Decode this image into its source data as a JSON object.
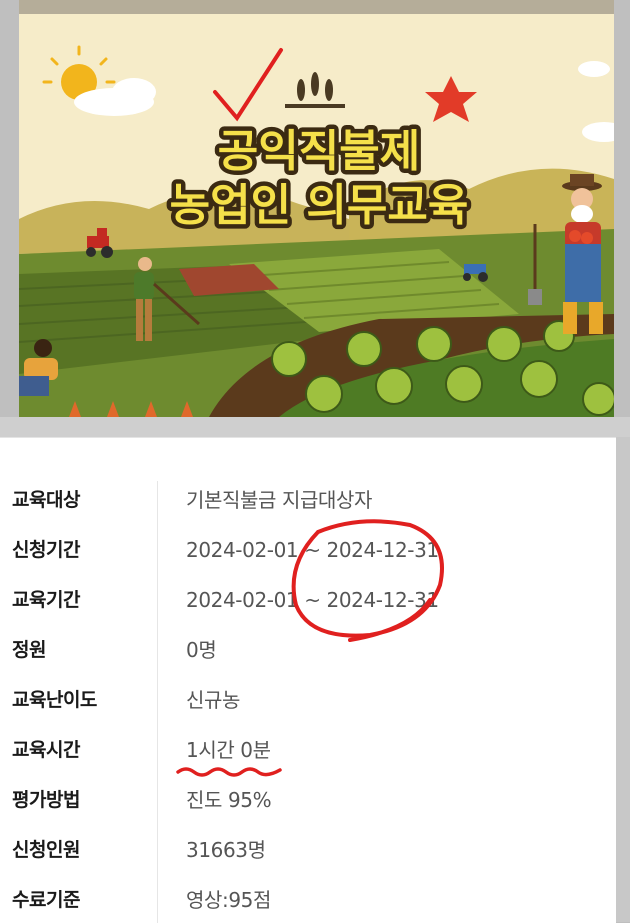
{
  "banner": {
    "title_line1": "공익직불제",
    "title_line2": "농업인 의무교육"
  },
  "rows": [
    {
      "label": "교육대상",
      "value": "기본직불금 지급대상자"
    },
    {
      "label": "신청기간",
      "value": "2024-02-01 ~ 2024-12-31"
    },
    {
      "label": "교육기간",
      "value": "2024-02-01 ~ 2024-12-31"
    },
    {
      "label": "정원",
      "value": "0명"
    },
    {
      "label": "교육난이도",
      "value": "신규농"
    },
    {
      "label": "교육시간",
      "value": "1시간 0분"
    },
    {
      "label": "평가방법",
      "value": "진도 95%"
    },
    {
      "label": "신청인원",
      "value": "31663명"
    },
    {
      "label": "수료기준",
      "value": "영상:95점"
    }
  ],
  "colors": {
    "annotation_red": "#e0201f",
    "title_yellow": "#f5e04a",
    "title_outline": "#3b2a12",
    "field_green": "#6e8b2f"
  }
}
